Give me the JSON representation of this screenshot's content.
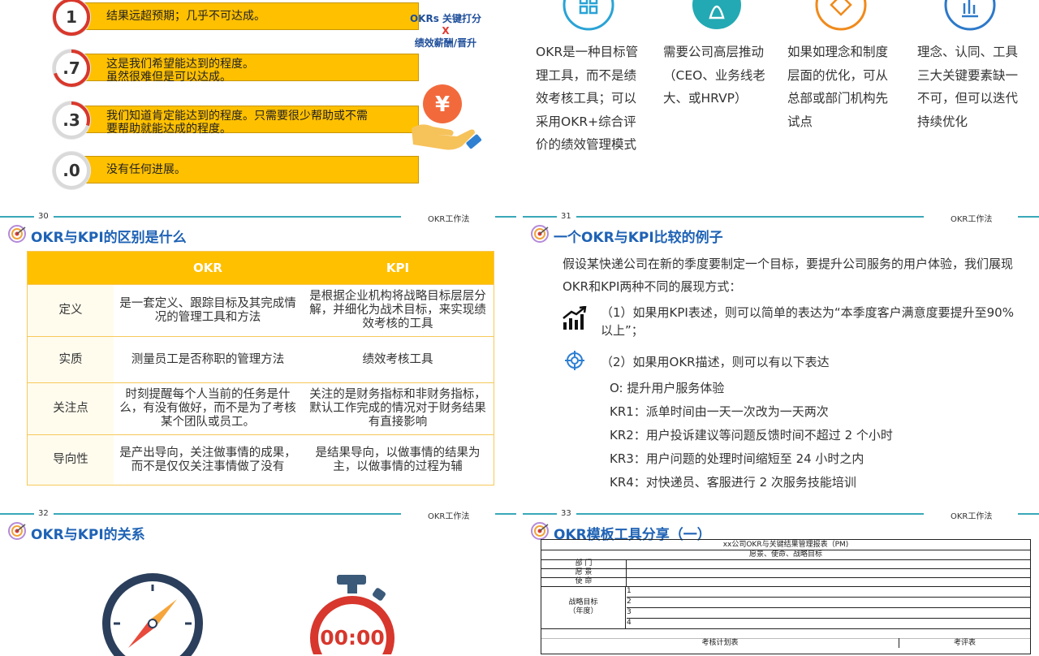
{
  "scores": [
    {
      "value": "1",
      "text": "结果远超预期；几乎不可达成。",
      "fraction": 1.0
    },
    {
      "value": ".7",
      "text": "这是我们希望能达到的程度。\n虽然很难但是可以达成。",
      "fraction": 0.7
    },
    {
      "value": ".3",
      "text": "我们知道肯定能达到的程度。只需要很少帮助或不需要帮助就能达成的程度。",
      "fraction": 0.3
    },
    {
      "value": ".0",
      "text": "没有任何进展。",
      "fraction": 0.0
    }
  ],
  "okr_link": {
    "line1": "OKRs 关键打分",
    "line2": "X",
    "line3": "绩效薪酬/晋升",
    "icon": "yen-hand-icon"
  },
  "principles": [
    {
      "icon": "clover-icon",
      "text": "OKR是一种目标管理工具，而不是绩效考核工具；可以采用OKR+综合评价的绩效管理模式",
      "color": "#2aa3d6"
    },
    {
      "icon": "leader-icon",
      "text": "需要公司高层推动（CEO、业务线老大、或HRVP）",
      "color": "#23a9b3"
    },
    {
      "icon": "diamond-icon",
      "text": "如果如理念和制度层面的优化，可从总部或部门机构先试点",
      "color": "#f08a1c"
    },
    {
      "icon": "bar-icon",
      "text": "理念、认同、工具三大关键要素缺一不可，但可以迭代持续优化",
      "color": "#2d79c9"
    }
  ],
  "slides": [
    {
      "number": "30",
      "brand": "OKR工作法",
      "title": "OKR与KPI的区别是什么"
    },
    {
      "number": "31",
      "brand": "OKR工作法",
      "title": "一个OKR与KPI比较的例子"
    },
    {
      "number": "32",
      "brand": "OKR工作法",
      "title": "OKR与KPI的关系"
    },
    {
      "number": "33",
      "brand": "OKR工作法",
      "title": "OKR模板工具分享（一）"
    }
  ],
  "comparison": {
    "headers": [
      "",
      "OKR",
      "KPI"
    ],
    "rows": [
      {
        "label": "定义",
        "okr": "是一套定义、跟踪目标及其完成情况的管理工具和方法",
        "kpi": "是根据企业机构将战略目标层层分解，并细化为战术目标，来实现绩效考核的工具"
      },
      {
        "label": "实质",
        "okr": "测量员工是否称职的管理方法",
        "kpi": "绩效考核工具"
      },
      {
        "label": "关注点",
        "okr": "时刻提醒每个人当前的任务是什么，有没有做好，而不是为了考核某个团队或员工。",
        "kpi": "关注的是财务指标和非财务指标，默认工作完成的情况对于财务结果有直接影响"
      },
      {
        "label": "导向性",
        "okr": "是产出导向，关注做事情的成果，而不是仅仅关注事情做了没有",
        "kpi": "是结果导向，以做事情的结果为主，以做事情的过程为辅"
      }
    ]
  },
  "example": {
    "intro": "假设某快递公司在新的季度要制定一个目标，要提升公司服务的用户体验，我们展现OKR和KPI两种不同的展现方式：",
    "kpi": "（1）如果用KPI表述，则可以简单的表达为“本季度客户满意度要提升至90%以上”；",
    "okr": "（2）如果用OKR描述，则可以有以下表达",
    "objective": "O: 提升用户服务体验",
    "krs": [
      "KR1：派单时间由一天一次改为一天两次",
      "KR2：用户投诉建议等问题反馈时间不超过 2 个小时",
      "KR3：用户问题的处理时间缩短至 24 小时之内",
      "KR4：对快递员、客服进行 2 次服务技能培训"
    ]
  },
  "relation": {
    "timer": "00:00",
    "icons": [
      "compass-icon",
      "stopwatch-icon"
    ]
  },
  "template_form": {
    "title": "xx公司OKR与关键结果管理报表（PM)",
    "subtitle": "愿景、使命、战略目标",
    "rows": [
      "部  门",
      "愿  景",
      "使  命"
    ],
    "strategy_label": "战略目标\n（年度）",
    "strategy_items": [
      "1",
      "2",
      "3",
      "4"
    ],
    "plan_label": "考核计划表",
    "review_label": "考评表"
  }
}
